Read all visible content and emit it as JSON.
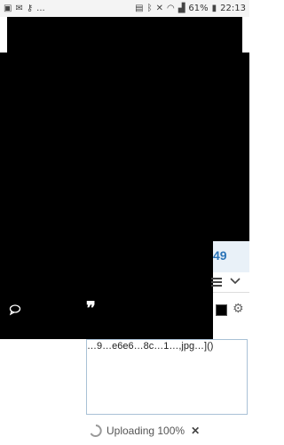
{
  "status_bar": {
    "left_icons": [
      "image-icon",
      "email-icon",
      "key-icon"
    ],
    "overflow": "...",
    "right_icons": [
      "lock-icon",
      "bluetooth-icon",
      "mute-icon",
      "wifi-icon",
      "signal-icon"
    ],
    "battery_percent": "61%",
    "time": "22:13"
  },
  "post": {
    "page_number": "49"
  },
  "editor": {
    "composer_text": "…9…e6e6…8c…1…,jpg…]()",
    "upload_status": "Uploading 100%",
    "cancel_symbol": "✕"
  },
  "colors": {
    "overlay": "#000000",
    "link_blue": "#2b74b8",
    "composer_border": "#a9c1d6"
  }
}
